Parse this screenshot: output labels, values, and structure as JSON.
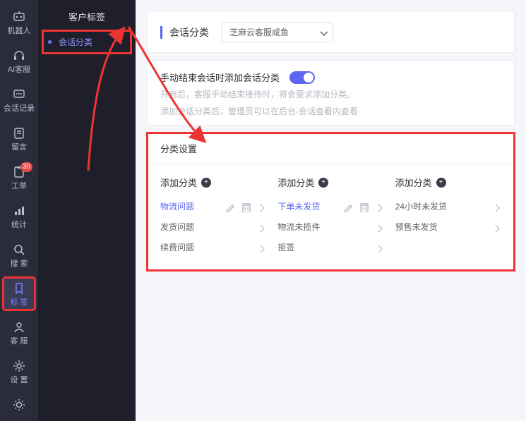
{
  "iconbar": {
    "items": [
      {
        "id": "robot",
        "label": "机器人",
        "icon": "robot"
      },
      {
        "id": "ai",
        "label": "AI客服",
        "icon": "headset"
      },
      {
        "id": "chat",
        "label": "会话记录",
        "icon": "chat"
      },
      {
        "id": "msg",
        "label": "留言",
        "icon": "note"
      },
      {
        "id": "ticket",
        "label": "工单",
        "icon": "ticket",
        "badge": "30"
      },
      {
        "id": "stats",
        "label": "统计",
        "icon": "stats"
      },
      {
        "id": "search",
        "label": "搜 索",
        "icon": "search"
      },
      {
        "id": "tags",
        "label": "标 签",
        "icon": "bookmark",
        "active": true,
        "highlight": true
      },
      {
        "id": "svc",
        "label": "客 服",
        "icon": "agent"
      },
      {
        "id": "set",
        "label": "设 置",
        "icon": "gear"
      }
    ]
  },
  "secbar": {
    "title": "客户标签",
    "nav": {
      "label": "会话分类"
    }
  },
  "header": {
    "title": "会话分类",
    "select_value": "芝麻云客服咸鱼"
  },
  "toggle": {
    "label": "手动结束会话时添加会话分类",
    "on": true,
    "help1": "开启后，客服手动结束接待时，将会要求添加分类。",
    "help2": "添加会话分类后，管理员可以在后台-会话查看内查看"
  },
  "categories": {
    "title": "分类设置",
    "add_label": "添加分类",
    "cols": [
      {
        "selected": 0,
        "items": [
          {
            "name": "物流问题",
            "editable": true
          },
          {
            "name": "发货问题"
          },
          {
            "name": "续费问题"
          }
        ]
      },
      {
        "selected": 0,
        "items": [
          {
            "name": "下单未发货",
            "editable": true
          },
          {
            "name": "物流未揽件"
          },
          {
            "name": "拒签"
          }
        ]
      },
      {
        "items": [
          {
            "name": "24小时未发货"
          },
          {
            "name": "预售未发货"
          }
        ]
      }
    ]
  }
}
